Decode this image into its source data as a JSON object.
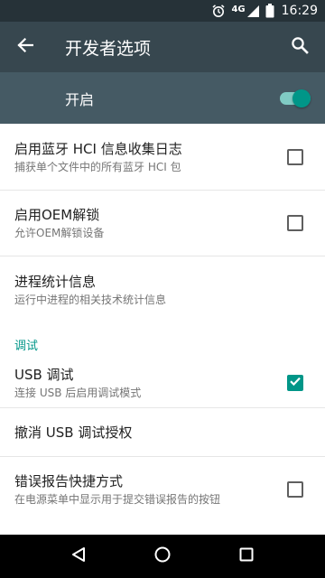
{
  "status_bar": {
    "network": "4G",
    "time": "16:29",
    "icons": [
      "alarm-icon",
      "signal-icon",
      "battery-icon"
    ]
  },
  "toolbar": {
    "title": "开发者选项",
    "back_icon": "arrow-back-icon",
    "search_icon": "search-icon"
  },
  "master_switch": {
    "label": "开启",
    "checked": true
  },
  "items": [
    {
      "title": "启用蓝牙 HCI 信息收集日志",
      "summary": "捕获单个文件中的所有蓝牙 HCI 包",
      "checked": false
    },
    {
      "title": "启用OEM解锁",
      "summary": "允许OEM解锁设备",
      "checked": false
    },
    {
      "title": "进程统计信息",
      "summary": "运行中进程的相关技术统计信息"
    }
  ],
  "debug_category": "调试",
  "debug_items": [
    {
      "title": "USB 调试",
      "summary": "连接 USB 后启用调试模式",
      "checked": true
    },
    {
      "title": "撤消 USB 调试授权"
    },
    {
      "title": "错误报告快捷方式",
      "summary": "在电源菜单中显示用于提交错误报告的按钮",
      "checked": false
    }
  ],
  "colors": {
    "accent": "#009688",
    "toolbar": "#37474f",
    "status_bar": "#263238",
    "switch_bar": "#455a64"
  }
}
